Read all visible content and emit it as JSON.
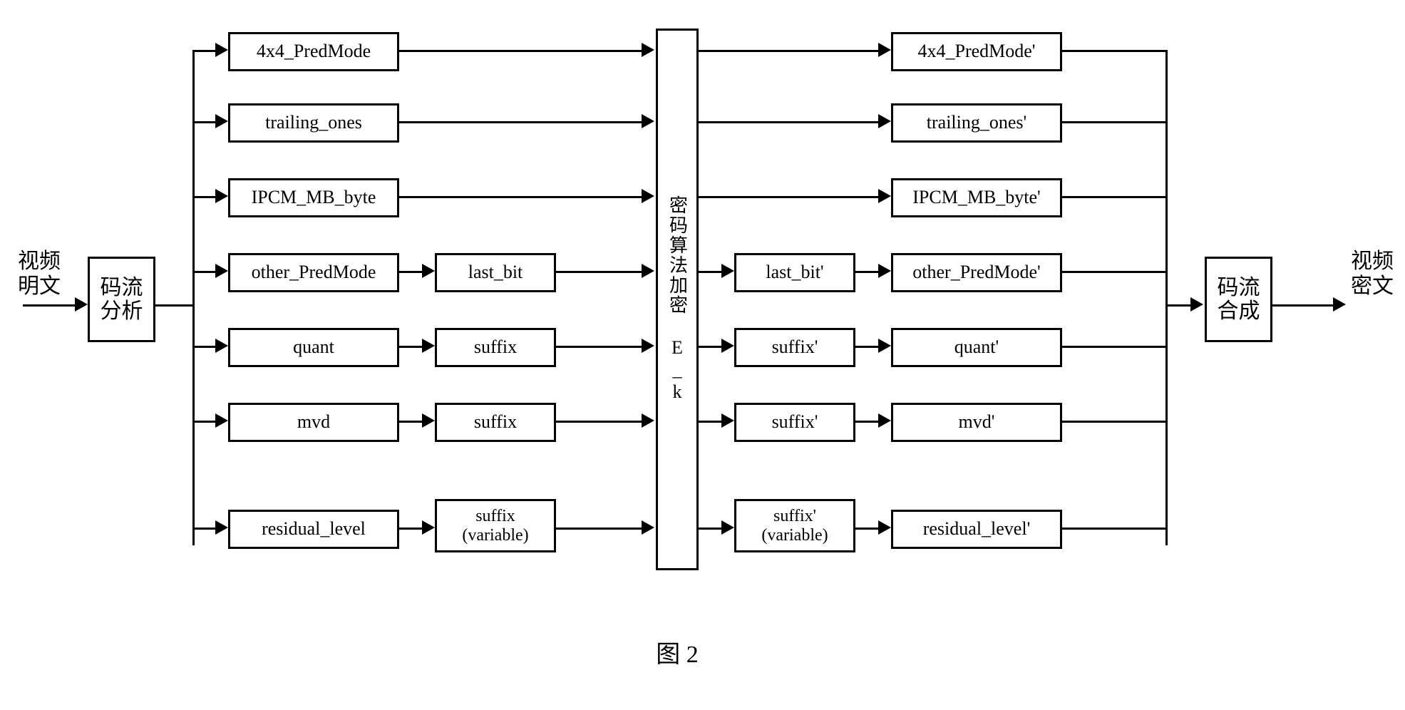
{
  "input_label": "视频\n明文",
  "output_label": "视频\n密文",
  "stream_parse": "码流\n分析",
  "stream_compose": "码流\n合成",
  "cipher_block": "密码算法加密 E_k",
  "left_items": [
    {
      "main": "4x4_PredMode",
      "sub": null
    },
    {
      "main": "trailing_ones",
      "sub": null
    },
    {
      "main": "IPCM_MB_byte",
      "sub": null
    },
    {
      "main": "other_PredMode",
      "sub": "last_bit"
    },
    {
      "main": "quant",
      "sub": "suffix"
    },
    {
      "main": "mvd",
      "sub": "suffix"
    },
    {
      "main": "residual_level",
      "sub": "suffix\n(variable)"
    }
  ],
  "right_items": [
    {
      "main": "4x4_PredMode'",
      "sub": null
    },
    {
      "main": "trailing_ones'",
      "sub": null
    },
    {
      "main": "IPCM_MB_byte'",
      "sub": null
    },
    {
      "main": "other_PredMode'",
      "sub": "last_bit'"
    },
    {
      "main": "quant'",
      "sub": "suffix'"
    },
    {
      "main": "mvd'",
      "sub": "suffix'"
    },
    {
      "main": "residual_level'",
      "sub": "suffix'\n(variable)"
    }
  ],
  "figure_caption": "图 2"
}
